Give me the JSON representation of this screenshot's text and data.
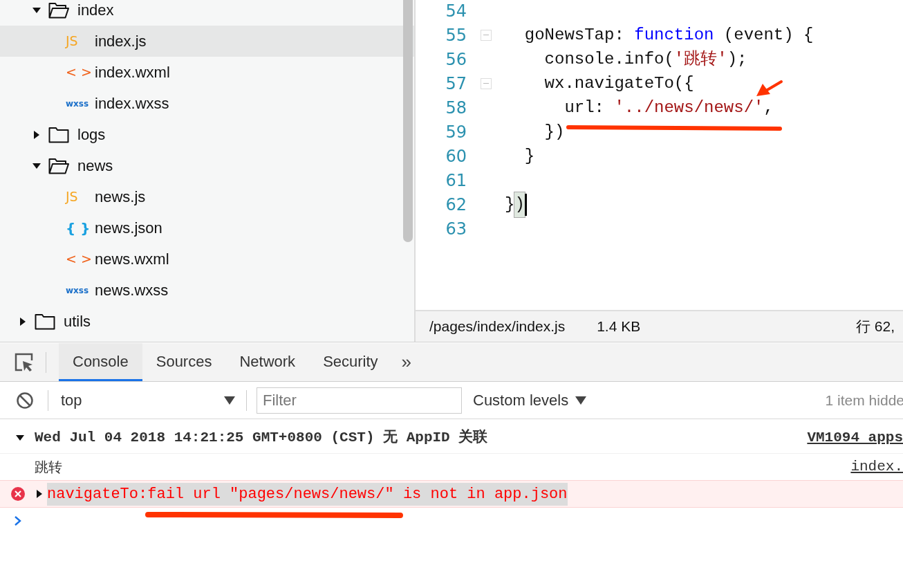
{
  "file_tree": [
    {
      "children": [
        {
          "kind": "folder",
          "name": "index",
          "expanded": true,
          "selected": false,
          "children": [
            {
              "kind": "js",
              "icon": "JS",
              "name": "index.js",
              "selected": true
            },
            {
              "kind": "wxml",
              "icon": "< >",
              "name": "index.wxml",
              "selected": false
            },
            {
              "kind": "wxss",
              "icon": "wxss",
              "name": "index.wxss",
              "selected": false
            }
          ]
        },
        {
          "kind": "folder",
          "name": "logs",
          "expanded": false,
          "selected": false
        },
        {
          "kind": "folder",
          "name": "news",
          "expanded": true,
          "selected": false,
          "children": [
            {
              "kind": "js",
              "icon": "JS",
              "name": "news.js",
              "selected": false
            },
            {
              "kind": "json",
              "icon": "{ }",
              "name": "news.json",
              "selected": false
            },
            {
              "kind": "wxml",
              "icon": "< >",
              "name": "news.wxml",
              "selected": false
            },
            {
              "kind": "wxss",
              "icon": "wxss",
              "name": "news.wxss",
              "selected": false
            }
          ]
        }
      ]
    },
    {
      "kind": "folder",
      "name": "utils",
      "expanded": false,
      "selected": false
    }
  ],
  "editor": {
    "lines": [
      {
        "number": "54",
        "fold": false,
        "cursor": false
      },
      {
        "number": "55",
        "fold": true,
        "cursor": false,
        "tokens": [
          {
            "kind": "plain",
            "text": "  goNewsTap: "
          },
          {
            "kind": "keyword",
            "text": "function"
          },
          {
            "kind": "plain",
            "text": " (event) {"
          }
        ]
      },
      {
        "number": "56",
        "fold": false,
        "cursor": false,
        "tokens": [
          {
            "kind": "plain",
            "text": "    console.info("
          },
          {
            "kind": "string",
            "text": "'跳转'"
          },
          {
            "kind": "plain",
            "text": ");"
          }
        ]
      },
      {
        "number": "57",
        "fold": true,
        "cursor": false,
        "tokens": [
          {
            "kind": "plain",
            "text": "    wx.navigateTo({"
          }
        ]
      },
      {
        "number": "58",
        "fold": false,
        "cursor": false,
        "tokens": [
          {
            "kind": "plain",
            "text": "      url: "
          },
          {
            "kind": "string",
            "text": "'../news/news/'"
          },
          {
            "kind": "plain",
            "text": ","
          }
        ]
      },
      {
        "number": "59",
        "fold": false,
        "cursor": false,
        "tokens": [
          {
            "kind": "plain",
            "text": "    })"
          }
        ]
      },
      {
        "number": "60",
        "fold": false,
        "cursor": false,
        "tokens": [
          {
            "kind": "plain",
            "text": "  }"
          }
        ]
      },
      {
        "number": "61",
        "fold": false,
        "cursor": false
      },
      {
        "number": "62",
        "fold": false,
        "cursor": true,
        "tokens": [
          {
            "kind": "plain",
            "text": "}"
          },
          {
            "kind": "match",
            "text": ")"
          }
        ]
      },
      {
        "number": "63",
        "fold": false,
        "cursor": false
      }
    ],
    "status_bar": {
      "path": "/pages/index/index.js",
      "size": "1.4 KB",
      "position": "行 62,"
    }
  },
  "devtools": {
    "tabs": [
      {
        "label": "Console",
        "selected": true
      },
      {
        "label": "Sources",
        "selected": false
      },
      {
        "label": "Network",
        "selected": false
      },
      {
        "label": "Security",
        "selected": false
      }
    ],
    "more": "»",
    "toolbar": {
      "context": "top",
      "filter": {
        "placeholder": "Filter"
      },
      "levels": "Custom levels",
      "hidden": "1 item hidde"
    },
    "messages": [
      {
        "kind": "group",
        "expanded": true,
        "text": "Wed Jul 04 2018 14:21:25 GMT+0800 (CST) 无 AppID 关联",
        "source": "VM1094 apps"
      },
      {
        "kind": "log",
        "text": "跳转",
        "source": "index."
      },
      {
        "kind": "error",
        "expanded": false,
        "text": "navigateTo:fail url \"pages/news/news/\" is not in app.json"
      }
    ]
  }
}
